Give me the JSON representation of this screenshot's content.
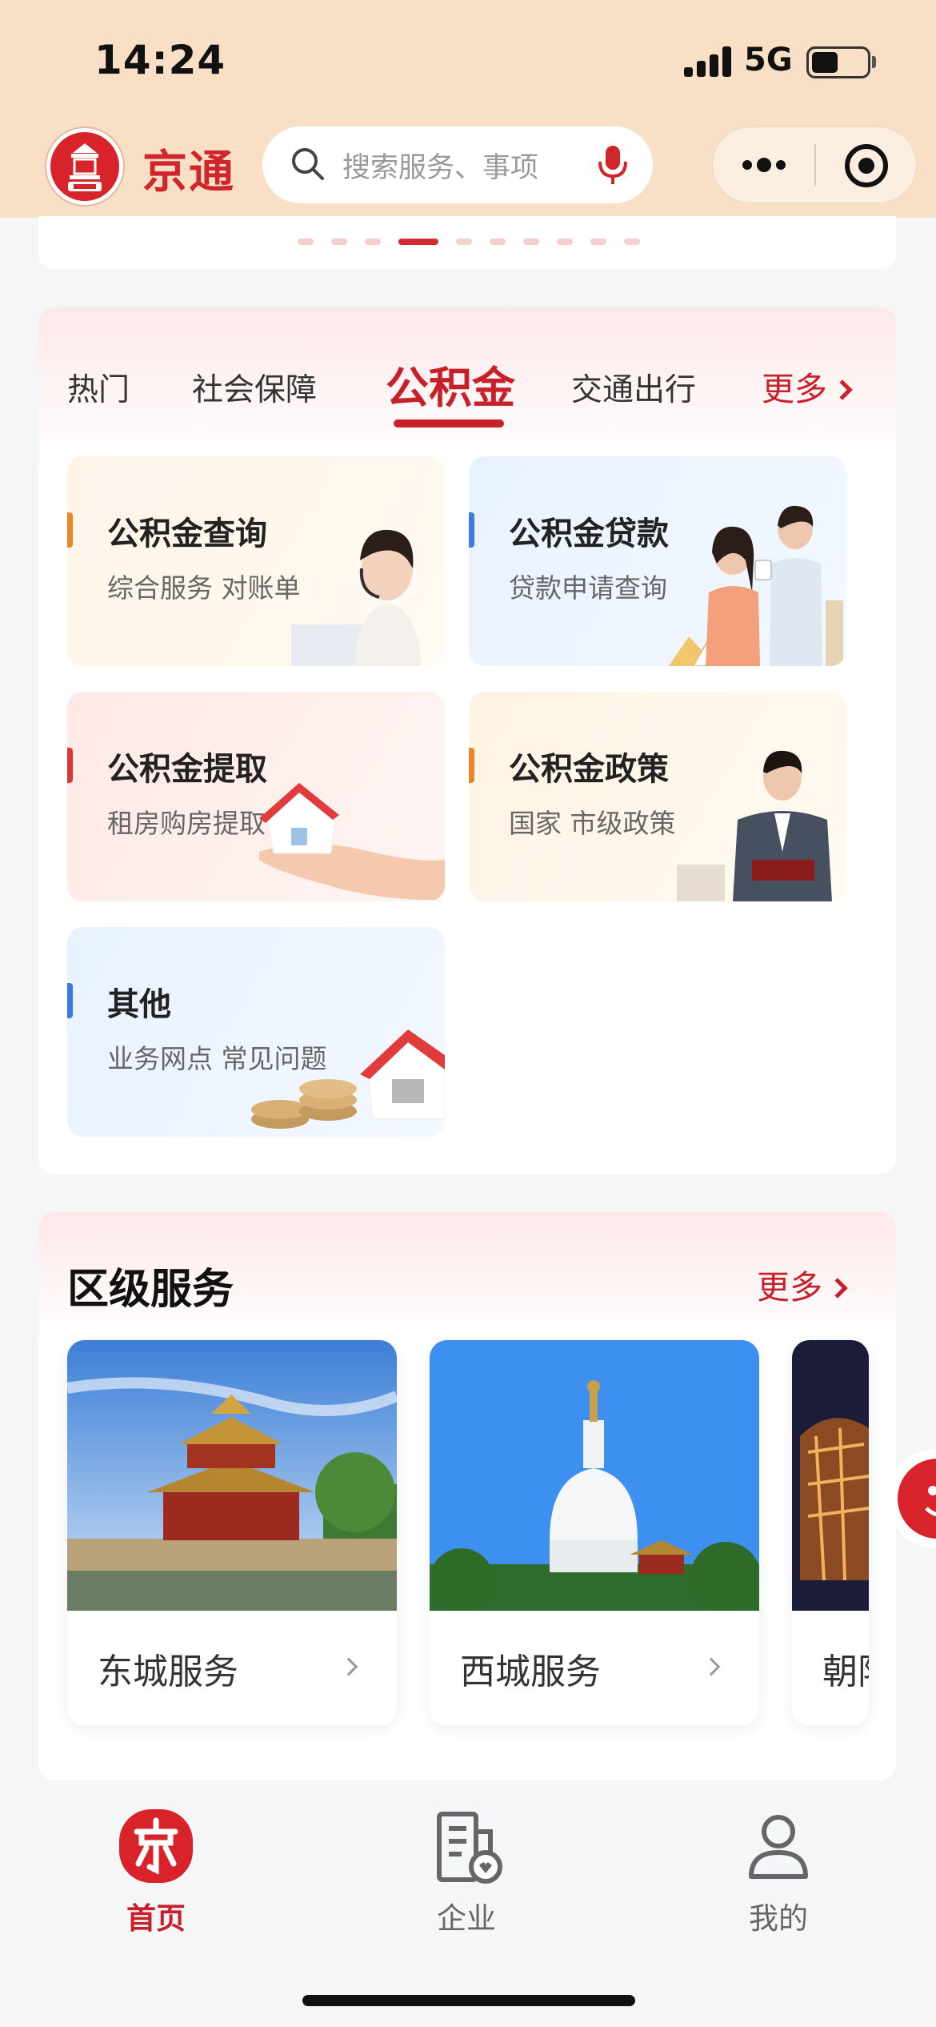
{
  "status_bar": {
    "time": "14:24",
    "network": "5G"
  },
  "header": {
    "logo_text": "京通",
    "search_placeholder": "搜索服务、事项"
  },
  "fund_section": {
    "tabs": [
      {
        "label": "热门"
      },
      {
        "label": "社会保障"
      },
      {
        "label": "公积金"
      },
      {
        "label": "交通出行"
      }
    ],
    "active_tab": "公积金",
    "more_label": "更多",
    "tiles": [
      {
        "title": "公积金查询",
        "subtitle": "综合服务 对账单",
        "accent": "#e8862a"
      },
      {
        "title": "公积金贷款",
        "subtitle": "贷款申请查询",
        "accent": "#3b7be0"
      },
      {
        "title": "公积金提取",
        "subtitle": "租房购房提取",
        "accent": "#d83a35"
      },
      {
        "title": "公积金政策",
        "subtitle": "国家 市级政策",
        "accent": "#e8862a"
      },
      {
        "title": "其他",
        "subtitle": "业务网点 常见问题",
        "accent": "#3b7be0"
      }
    ]
  },
  "district_section": {
    "title": "区级服务",
    "more_label": "更多",
    "cards": [
      {
        "name": "东城服务"
      },
      {
        "name": "西城服务"
      },
      {
        "name": "朝阳服务"
      }
    ]
  },
  "bottom_nav": {
    "items": [
      {
        "label": "首页",
        "icon": "home-icon",
        "active": true
      },
      {
        "label": "企业",
        "icon": "enterprise-icon",
        "active": false
      },
      {
        "label": "我的",
        "icon": "profile-icon",
        "active": false
      }
    ]
  },
  "colors": {
    "brand_red": "#c8202a",
    "header_bg": "#f9dfc5"
  }
}
